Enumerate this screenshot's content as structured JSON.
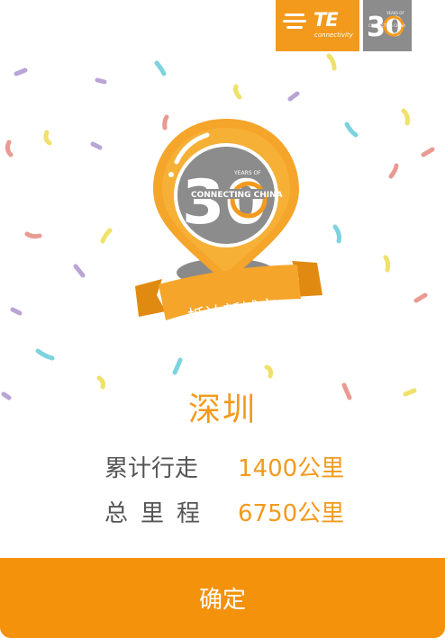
{
  "logos": {
    "brand_text": "TE",
    "brand_subtext": "connectivity",
    "anniversary_number": "30",
    "anniversary_tagline": "CONNECTING CHINA",
    "anniversary_years_text": "YEARS OF"
  },
  "badge": {
    "years_text": "YEARS OF",
    "number": "30",
    "tagline": "CONNECTING CHINA",
    "ribbon_text": "抵达新城市"
  },
  "city": "深圳",
  "stats": [
    {
      "label": "累计行走",
      "value": "1400公里"
    },
    {
      "label": "总里程",
      "value": "6750公里"
    }
  ],
  "confirm_button": {
    "label": "确定"
  },
  "colors": {
    "accent": "#f4920c",
    "grey": "#8c8c8c",
    "text_grey": "#555555"
  }
}
